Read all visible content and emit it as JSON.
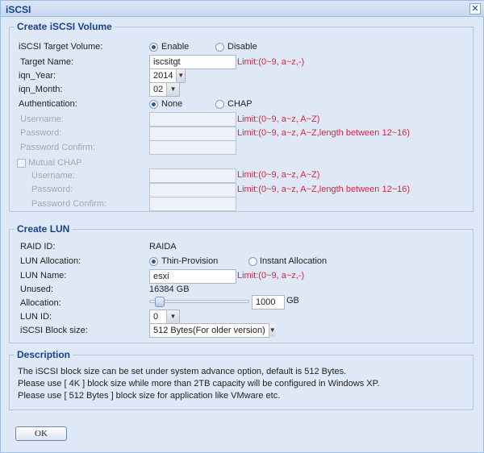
{
  "window": {
    "title": "iSCSI",
    "close_icon": "close-icon"
  },
  "volume": {
    "legend": "Create iSCSI Volume",
    "target_volume_label": "iSCSI Target Volume:",
    "enable": "Enable",
    "disable": "Disable",
    "target_volume_selected": "Enable",
    "target_name_label": "Target Name:",
    "target_name_value": "iscsitgt",
    "target_name_limit": "Limit:(0~9, a~z,-)",
    "iqn_year_label": "iqn_Year:",
    "iqn_year_value": "2014",
    "iqn_month_label": "iqn_Month:",
    "iqn_month_value": "02",
    "auth_label": "Authentication:",
    "auth_none": "None",
    "auth_chap": "CHAP",
    "auth_selected": "None",
    "username_label": "Username:",
    "username_limit": "Limit:(0~9, a~z, A~Z)",
    "password_label": "Password:",
    "password_limit": "Limit:(0~9, a~z, A~Z,length between 12~16)",
    "password_confirm_label": "Password Confirm:",
    "mutual_chap_label": "Mutual CHAP",
    "m_username_label": "Username:",
    "m_username_limit": "Limit:(0~9, a~z, A~Z)",
    "m_password_label": "Password:",
    "m_password_limit": "Limit:(0~9, a~z, A~Z,length between 12~16)",
    "m_password_confirm_label": "Password Confirm:"
  },
  "lun": {
    "legend": "Create LUN",
    "raid_id_label": "RAID ID:",
    "raid_id_value": "RAIDA",
    "allocation_type_label": "LUN Allocation:",
    "thin": "Thin-Provision",
    "instant": "Instant Allocation",
    "allocation_type_selected": "Thin-Provision",
    "name_label": "LUN Name:",
    "name_value": "esxi",
    "name_limit": "Limit:(0~9, a~z,-)",
    "unused_label": "Unused:",
    "unused_value": "16384 GB",
    "allocation_label": "Allocation:",
    "allocation_value": "1000",
    "allocation_unit": "GB",
    "allocation_fraction": 0.061,
    "lun_id_label": "LUN ID:",
    "lun_id_value": "0",
    "block_size_label": "iSCSI Block size:",
    "block_size_value": "512 Bytes(For older version)"
  },
  "description": {
    "legend": "Description",
    "lines": [
      "The iSCSI block size can be set under system advance option, default is 512 Bytes.",
      "Please use [ 4K ] block size while more than 2TB capacity will be configured in Windows XP.",
      "Please use [ 512 Bytes ] block size for application like VMware etc."
    ]
  },
  "ok_label": "OK"
}
